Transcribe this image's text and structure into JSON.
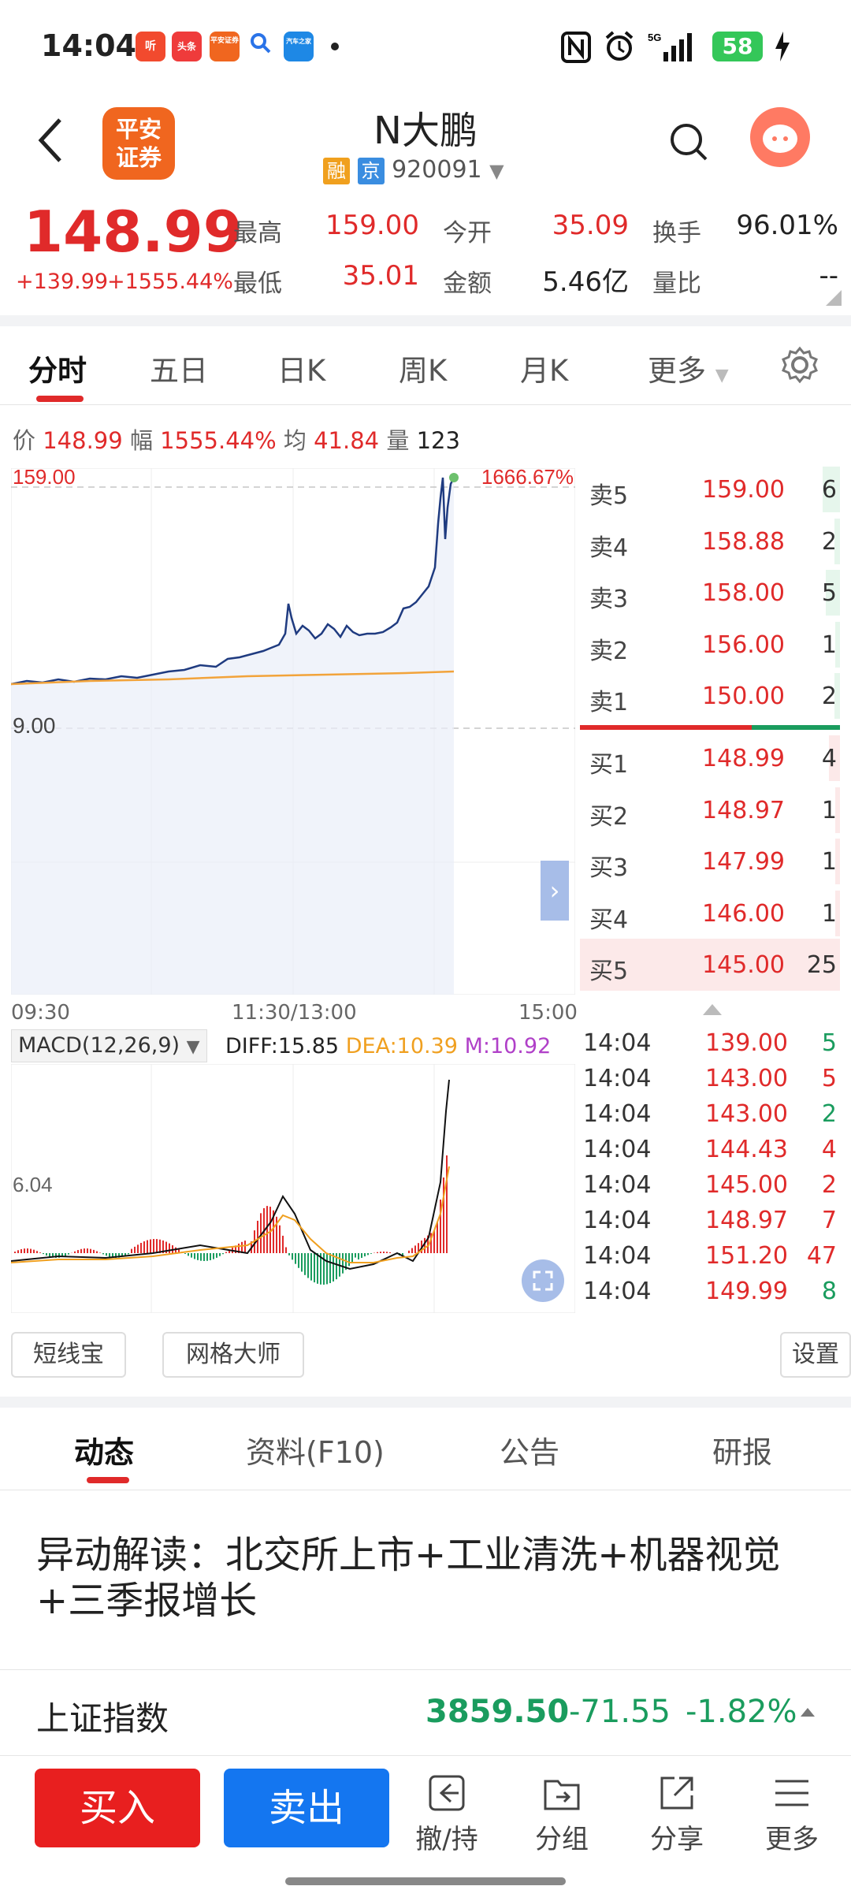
{
  "status_bar": {
    "time": "14:04",
    "battery": "58",
    "network": "5G",
    "icons": [
      "ting-app-icon",
      "toutiao-app-icon",
      "pingan-app-icon",
      "search-icon",
      "qiche-app-icon",
      "nfc-icon",
      "alarm-icon",
      "signal-icon",
      "battery-icon",
      "charging-icon"
    ],
    "app_labels": {
      "ting": "听",
      "toutiao": "头条",
      "pingan": "平安证券",
      "qiche": "汽车之家"
    }
  },
  "header": {
    "logo_line1": "平安",
    "logo_line2": "证券",
    "stock_name": "N大鹏",
    "tag1": "融",
    "tag2": "京",
    "code": "920091",
    "tag1_color": "#f0a01e",
    "tag2_color": "#3a8de0"
  },
  "quote": {
    "price": "148.99",
    "change": "+139.99",
    "change_pct": "+1555.44%",
    "labels": {
      "high": "最高",
      "low": "最低",
      "open": "今开",
      "amount": "金额",
      "turnover": "换手",
      "ratio": "量比"
    },
    "high": "159.00",
    "low": "35.01",
    "open": "35.09",
    "amount": "5.46亿",
    "turnover": "96.01%",
    "ratio": "--"
  },
  "tabs": [
    "分时",
    "五日",
    "日K",
    "周K",
    "月K",
    "更多"
  ],
  "info": {
    "price_lbl": "价",
    "price": "148.99",
    "amp_lbl": "幅",
    "amp": "1555.44%",
    "avg_lbl": "均",
    "avg": "41.84",
    "vol_lbl": "量",
    "vol": "123"
  },
  "chart_axis": {
    "top_price": "159.00",
    "top_pct": "1666.67%",
    "ref_price": "9.00",
    "t_start": "09:30",
    "t_mid": "11:30/13:00",
    "t_end": "15:00",
    "macd_axis": "6.04"
  },
  "macd": {
    "label": "MACD(12,26,9)",
    "diff": "DIFF:15.85",
    "dea": "DEA:10.39",
    "m": "M:10.92"
  },
  "order_book": {
    "sells": [
      {
        "label": "卖5",
        "price": "159.00",
        "vol": "6",
        "bar": 0.24
      },
      {
        "label": "卖4",
        "price": "158.88",
        "vol": "2",
        "bar": 0.08
      },
      {
        "label": "卖3",
        "price": "158.00",
        "vol": "5",
        "bar": 0.2
      },
      {
        "label": "卖2",
        "price": "156.00",
        "vol": "1",
        "bar": 0.04
      },
      {
        "label": "卖1",
        "price": "150.00",
        "vol": "2",
        "bar": 0.08
      }
    ],
    "buys": [
      {
        "label": "买1",
        "price": "148.99",
        "vol": "4",
        "bar": 0.16
      },
      {
        "label": "买2",
        "price": "148.97",
        "vol": "1",
        "bar": 0.04
      },
      {
        "label": "买3",
        "price": "147.99",
        "vol": "1",
        "bar": 0.04
      },
      {
        "label": "买4",
        "price": "146.00",
        "vol": "1",
        "bar": 0.04
      },
      {
        "label": "买5",
        "price": "145.00",
        "vol": "25",
        "bar": 1.0
      }
    ]
  },
  "ticks": [
    {
      "time": "14:04",
      "price": "139.00",
      "vol": "5",
      "dir": "down"
    },
    {
      "time": "14:04",
      "price": "143.00",
      "vol": "5",
      "dir": "up"
    },
    {
      "time": "14:04",
      "price": "143.00",
      "vol": "2",
      "dir": "down"
    },
    {
      "time": "14:04",
      "price": "144.43",
      "vol": "4",
      "dir": "up"
    },
    {
      "time": "14:04",
      "price": "145.00",
      "vol": "2",
      "dir": "up"
    },
    {
      "time": "14:04",
      "price": "148.97",
      "vol": "7",
      "dir": "up"
    },
    {
      "time": "14:04",
      "price": "151.20",
      "vol": "47",
      "dir": "up"
    },
    {
      "time": "14:04",
      "price": "149.99",
      "vol": "8",
      "dir": "down"
    }
  ],
  "tools": {
    "short": "短线宝",
    "grid": "网格大师",
    "settings": "设置"
  },
  "bottom_tabs": [
    "动态",
    "资料(F10)",
    "公告",
    "研报"
  ],
  "news": "异动解读：北交所上市+工业清洗+机器视觉+三季报增长",
  "index": {
    "name": "上证指数",
    "value": "3859.50",
    "change": "-71.55",
    "pct": "-1.82%"
  },
  "actions": {
    "buy": "买入",
    "sell": "卖出",
    "cancel": "撤/持",
    "group": "分组",
    "share": "分享",
    "more": "更多"
  },
  "colors": {
    "up": "#e02a2a",
    "down": "#1a9c5e",
    "buy_btn": "#e81f1f",
    "sell_btn": "#1476f0"
  }
}
